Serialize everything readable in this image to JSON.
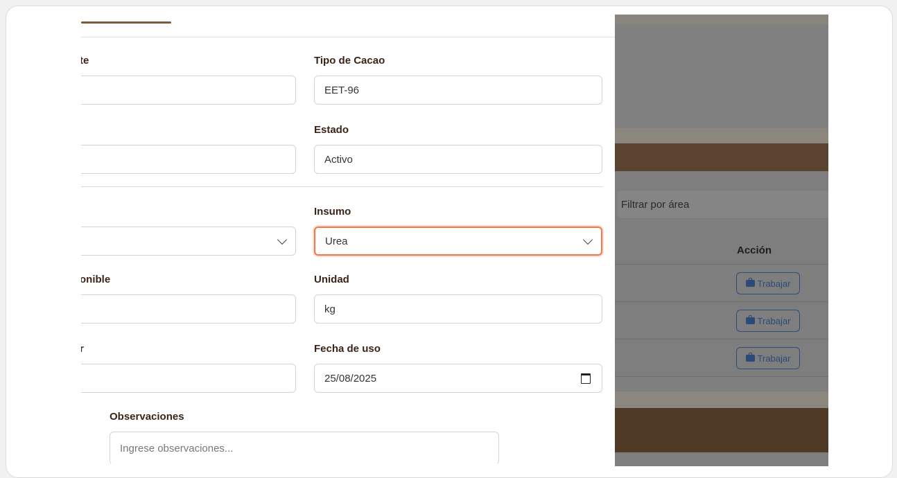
{
  "form": {
    "labels": {
      "lote_partial": "te",
      "tipo_cacao": "Tipo de Cacao",
      "estado": "Estado",
      "insumo": "Insumo",
      "disponible_partial": "onible",
      "unidad": "Unidad",
      "cantidad_partial": "r",
      "fecha_uso": "Fecha de uso",
      "observaciones": "Observaciones"
    },
    "values": {
      "tipo_cacao": "EET-96",
      "estado": "Activo",
      "insumo": "Urea",
      "unidad": "kg",
      "fecha_uso": "25/08/2025"
    },
    "placeholders": {
      "observaciones": "Ingrese observaciones..."
    }
  },
  "background": {
    "filter_placeholder": "Filtrar por área",
    "table_header_action": "Acción",
    "row_buttons": [
      "Trabajar",
      "Trabajar",
      "Trabajar"
    ]
  },
  "colors": {
    "focus_ring": "#f2784b",
    "label_text": "#3a2418",
    "brand_brown": "#5a3e26"
  }
}
